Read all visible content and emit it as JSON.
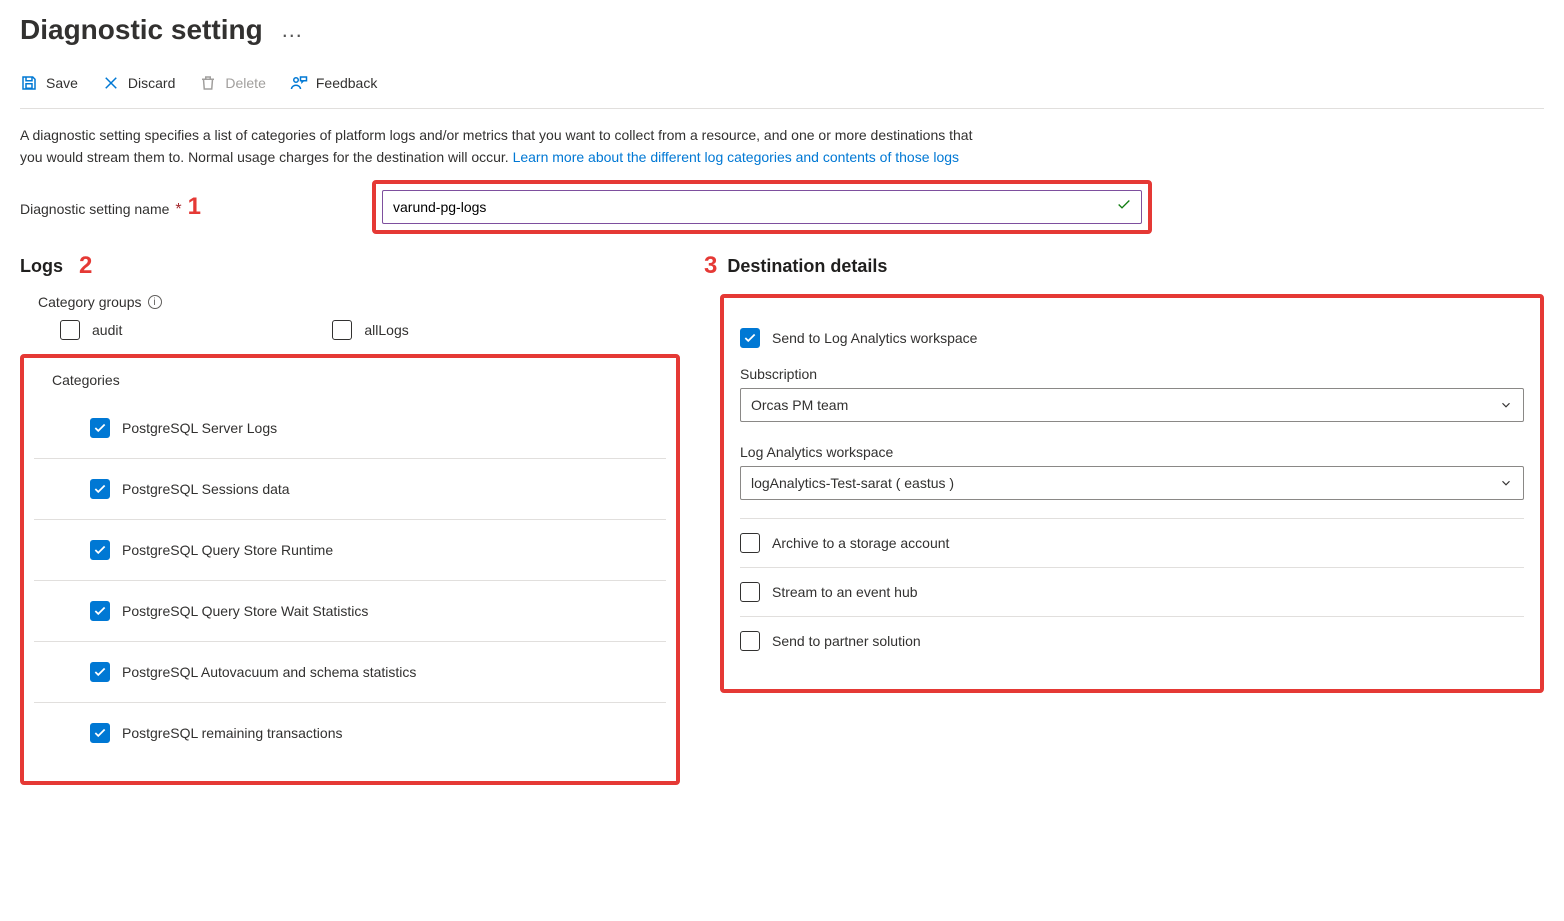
{
  "page": {
    "title": "Diagnostic setting",
    "description_pre": "A diagnostic setting specifies a list of categories of platform logs and/or metrics that you want to collect from a resource, and one or more destinations that you would stream them to. Normal usage charges for the destination will occur. ",
    "learn_more": "Learn more about the different log categories and contents of those logs"
  },
  "toolbar": {
    "save": "Save",
    "discard": "Discard",
    "delete": "Delete",
    "feedback": "Feedback"
  },
  "name_field": {
    "label": "Diagnostic setting name",
    "value": "varund-pg-logs"
  },
  "annotations": {
    "n1": "1",
    "n2": "2",
    "n3": "3"
  },
  "logs": {
    "heading": "Logs",
    "category_groups_label": "Category groups",
    "groups": {
      "audit": "audit",
      "allLogs": "allLogs"
    },
    "categories_label": "Categories",
    "categories": [
      {
        "label": "PostgreSQL Server Logs"
      },
      {
        "label": "PostgreSQL Sessions data"
      },
      {
        "label": "PostgreSQL Query Store Runtime"
      },
      {
        "label": "PostgreSQL Query Store Wait Statistics"
      },
      {
        "label": "PostgreSQL Autovacuum and schema statistics"
      },
      {
        "label": "PostgreSQL remaining transactions"
      }
    ]
  },
  "dest": {
    "heading": "Destination details",
    "law": {
      "label": "Send to Log Analytics workspace",
      "subscription_label": "Subscription",
      "subscription_value": "Orcas PM team",
      "workspace_label": "Log Analytics workspace",
      "workspace_value": "logAnalytics-Test-sarat ( eastus )"
    },
    "storage": "Archive to a storage account",
    "eventhub": "Stream to an event hub",
    "partner": "Send to partner solution"
  }
}
